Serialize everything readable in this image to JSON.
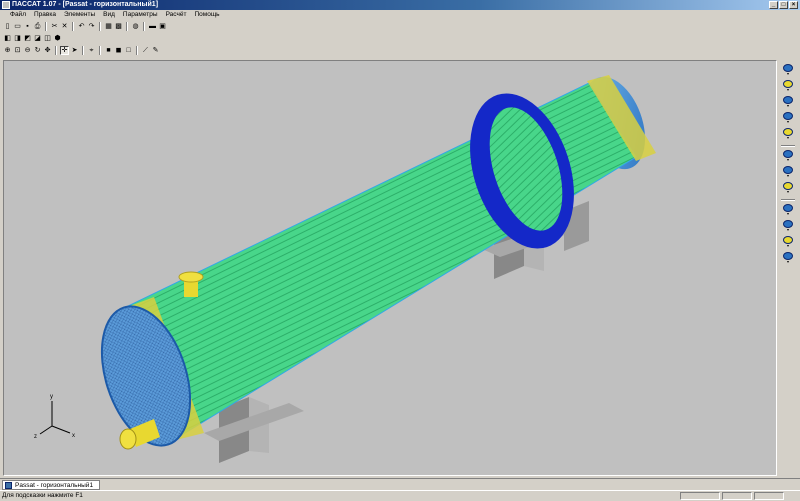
{
  "window": {
    "title": "ПАССАТ 1.07 - [Passat - горизонтальный1]"
  },
  "menu": {
    "items": [
      "Файл",
      "Правка",
      "Элементы",
      "Вид",
      "Параметры",
      "Расчёт",
      "Помощь"
    ]
  },
  "toolbar1": [
    {
      "name": "new-document-icon",
      "glyph": "▯"
    },
    {
      "name": "open-folder-icon",
      "glyph": "▭"
    },
    {
      "name": "save-icon",
      "glyph": "▪"
    },
    {
      "name": "print-icon",
      "glyph": "⎙"
    },
    {
      "name": "cut-icon",
      "glyph": "✂"
    },
    {
      "name": "delete-icon",
      "glyph": "✕"
    },
    {
      "name": "undo-icon",
      "glyph": "↶"
    },
    {
      "name": "redo-icon",
      "glyph": "↷"
    },
    {
      "name": "table-icon",
      "glyph": "▦"
    },
    {
      "name": "grid-icon",
      "glyph": "▩"
    },
    {
      "name": "globe-icon",
      "glyph": "◍"
    },
    {
      "name": "rectangle-view-icon",
      "glyph": "▬"
    },
    {
      "name": "close-panel-icon",
      "glyph": "▣"
    }
  ],
  "toolbar2": [
    {
      "name": "view-front-icon",
      "glyph": "◧"
    },
    {
      "name": "view-back-icon",
      "glyph": "◨"
    },
    {
      "name": "view-left-icon",
      "glyph": "◩"
    },
    {
      "name": "view-right-icon",
      "glyph": "◪"
    },
    {
      "name": "view-top-icon",
      "glyph": "◫"
    },
    {
      "name": "view-iso-icon",
      "glyph": "⬢"
    }
  ],
  "toolbar3": [
    {
      "name": "zoom-in-icon",
      "glyph": "⊕"
    },
    {
      "name": "zoom-window-icon",
      "glyph": "⊡"
    },
    {
      "name": "zoom-out-icon",
      "glyph": "⊖"
    },
    {
      "name": "rotate-icon",
      "glyph": "↻"
    },
    {
      "name": "pan-icon",
      "glyph": "✥"
    },
    {
      "name": "move-icon",
      "glyph": "✛",
      "active": true
    },
    {
      "name": "select-arrow-icon",
      "glyph": "➤"
    },
    {
      "name": "cursor-icon",
      "glyph": "⌖"
    },
    {
      "name": "solid-view-icon",
      "glyph": "■"
    },
    {
      "name": "shaded-view-icon",
      "glyph": "◼"
    },
    {
      "name": "wireframe-view-icon",
      "glyph": "□"
    },
    {
      "name": "measure-icon",
      "glyph": "⟋"
    },
    {
      "name": "paint-icon",
      "glyph": "✎"
    }
  ],
  "rightbar": [
    "cylinder-shell-icon",
    "nozzle-icon",
    "flange-ring-icon",
    "elliptic-head-icon",
    "flat-head-icon",
    "tube-bundle-icon",
    "baffle-icon",
    "tubesheet-icon",
    "saddle-support-icon",
    "axis-icon",
    "coordinate-system-icon",
    "heat-exchanger-icon"
  ],
  "axes": {
    "x": "x",
    "y": "y",
    "z": "z"
  },
  "document_tab": {
    "label": "Passat - горизонтальный1"
  },
  "status": {
    "hint": "Для подсказки нажмите F1"
  },
  "colors": {
    "shell": "#2ecc71",
    "flange": "#1428c8",
    "head": "#4aa0e0",
    "tubesheet": "#e8d830",
    "support": "#9a9a9a",
    "viewport": "#c0c0c0"
  }
}
